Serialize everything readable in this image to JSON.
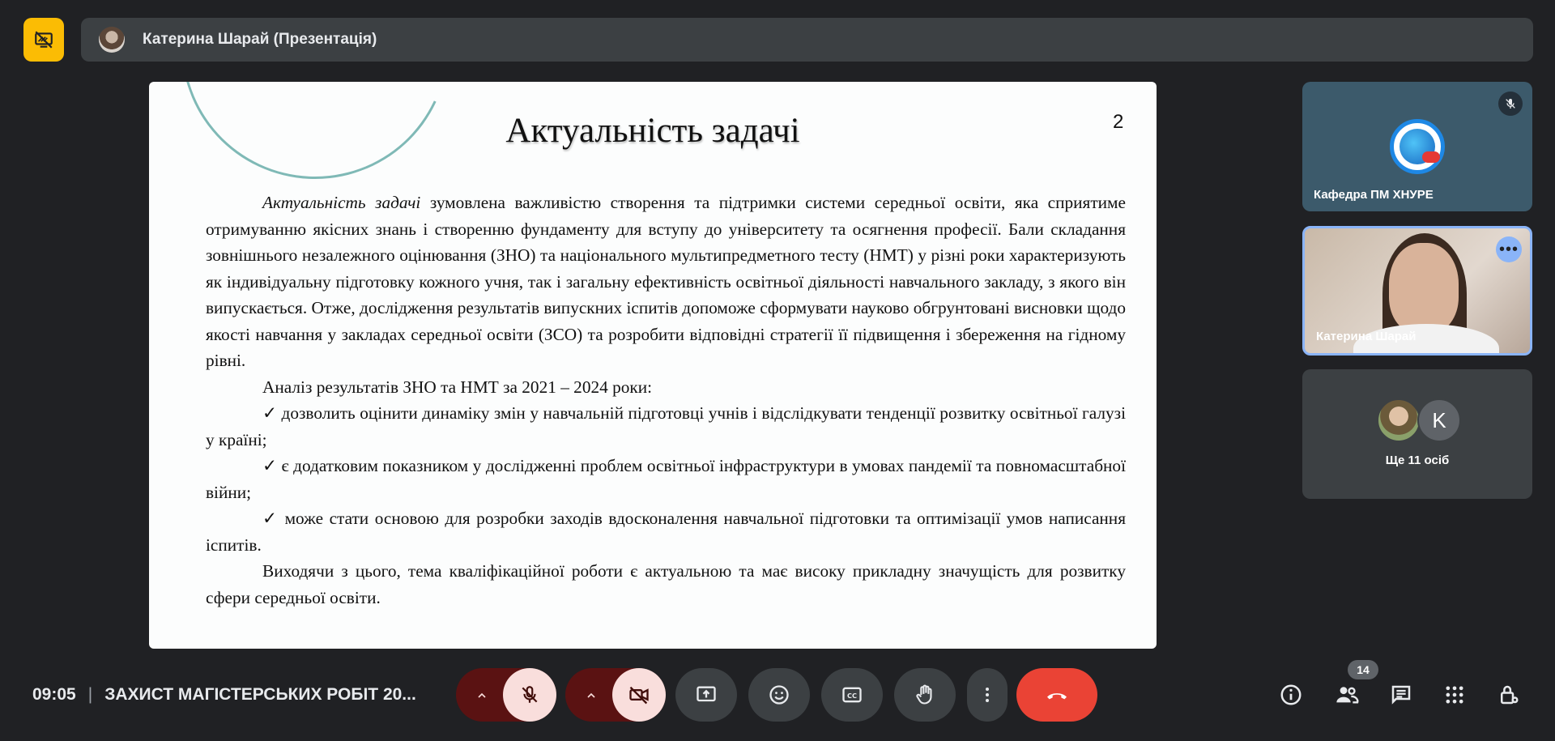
{
  "presentation_bar": {
    "presenter": "Катерина Шарай (Презентація)"
  },
  "slide": {
    "title": "Актуальність задачі",
    "number": "2",
    "intro_italic": "Актуальність задачі",
    "intro_rest": " зумовлена важливістю створення та підтримки системи середньої освіти, яка сприятиме отримуванню якісних знань і створенню фундаменту для вступу до університету та осягнення професії. Бали складання зовнішнього незалежного оцінювання (ЗНО) та національного мультипредметного тесту (НМТ) у різні роки характеризують як індивідуальну підготовку кожного учня, так і загальну ефективність освітньої діяльності навчального закладу, з якого він випускається. Отже, дослідження результатів випускних іспитів допоможе сформувати науково обгрунтовані висновки щодо якості навчання у закладах середньої освіти (ЗСО) та розробити відповідні стратегії її підвищення і збереження на гідному рівні.",
    "analysis_heading": "Аналіз результатів ЗНО та НМТ за 2021 – 2024 роки:",
    "bullets": [
      "✓ дозволить оцінити динаміку змін у навчальній підготовці учнів і відслідкувати тенденції розвитку освітньої галузі у країні;",
      "✓ є додатковим показником у дослідженні проблем освітньої інфраструктури в умовах пандемії та повномасштабної війни;",
      "✓ може стати основою для розробки заходів вдосконалення навчальної підготовки та оптимізації умов написання іспитів."
    ],
    "conclusion": "Виходячи з цього, тема кваліфікаційної роботи є актуальною та має високу прикладну значущість для розвитку сфери середньої освіти."
  },
  "participants": {
    "tile1_name": "Кафедра ПМ ХНУРЕ",
    "tile2_name": "Катерина Шарай",
    "tile3_initial": "K",
    "tile3_label": "Ще 11 осіб"
  },
  "bottom_bar": {
    "time": "09:05",
    "meeting_title": "ЗАХИСТ МАГІСТЕРСЬКИХ РОБІТ 20...",
    "participants_count": "14"
  },
  "icons": {
    "present_stop": "present-off-icon",
    "mic": "mic-off-icon",
    "camera": "camera-off-icon",
    "share": "present-to-all-icon",
    "emoji": "emoji-icon",
    "captions": "captions-icon",
    "hand": "raise-hand-icon",
    "more": "more-vert-icon",
    "hangup": "call-end-icon",
    "info": "info-icon",
    "people": "people-icon",
    "chat": "chat-icon",
    "activities": "apps-icon",
    "host": "host-controls-icon"
  },
  "colors": {
    "background": "#202124",
    "bar": "#3c4043",
    "accent_yellow": "#fbbc04",
    "hangup_red": "#ea4335",
    "muted_dark_red": "#5a1212",
    "muted_light": "#f9dedc",
    "speaking_border": "#8ab4f8"
  }
}
